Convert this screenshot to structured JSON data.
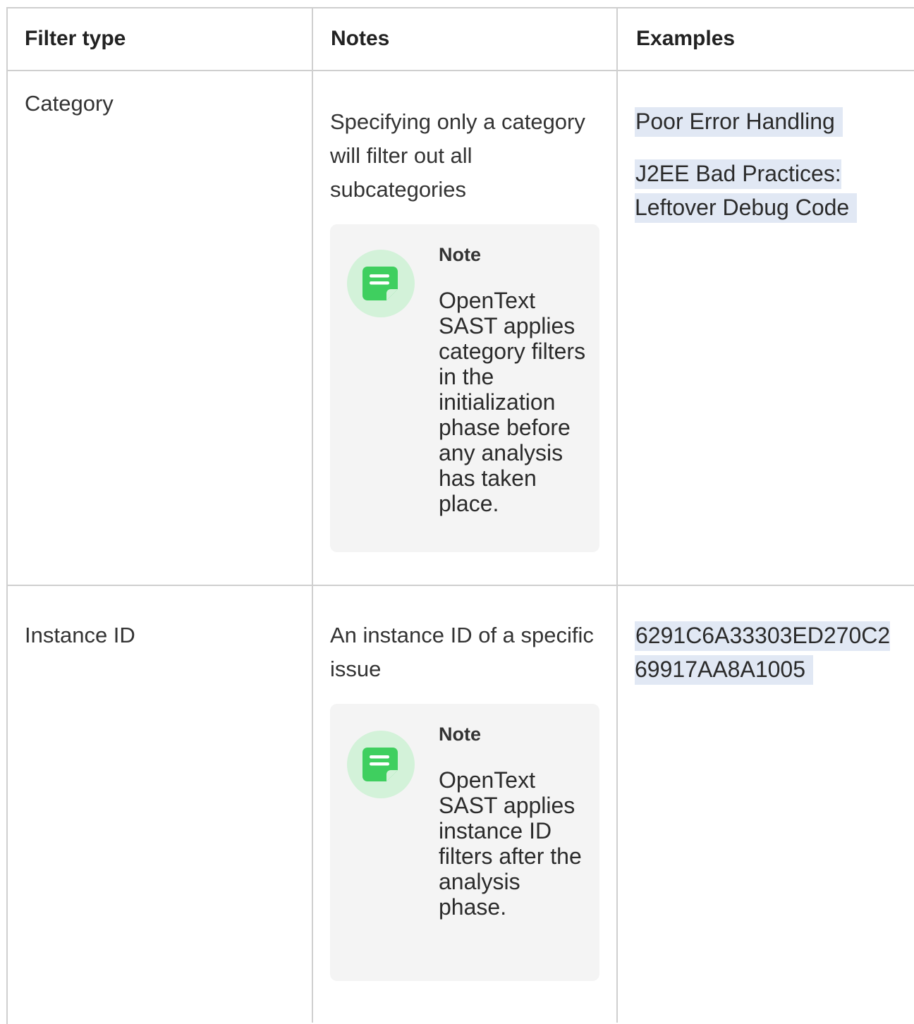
{
  "table": {
    "headers": [
      "Filter type",
      "Notes",
      "Examples"
    ],
    "rows": [
      {
        "filter_type": "Category",
        "notes": "Specifying only a category will filter out all subcategories",
        "note_callout": {
          "title": "Note",
          "body": "OpenText SAST applies category filters in the initialization phase before any analysis has taken place."
        },
        "examples": [
          "Poor Error Handling",
          "J2EE Bad Practices: Leftover Debug Code"
        ]
      },
      {
        "filter_type": "Instance ID",
        "notes": "An instance ID of a specific issue",
        "note_callout": {
          "title": "Note",
          "body": "OpenText SAST applies instance ID filters after the analysis phase."
        },
        "examples": [
          "6291C6A33303ED270C269917AA8A1005"
        ]
      }
    ]
  },
  "colors": {
    "border": "#cfcfcf",
    "note_background": "#f4f4f4",
    "note_icon_circle": "#d3f2d9",
    "note_icon": "#3fcf5f",
    "code_highlight": "#e1e8f4"
  },
  "icons": {
    "note": "sticky-note-icon"
  }
}
